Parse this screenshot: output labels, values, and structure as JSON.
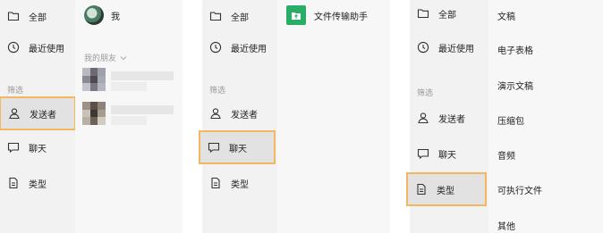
{
  "panel1": {
    "menu": [
      "全部",
      "最近使用"
    ],
    "filter_label": "筛选",
    "filters": [
      "发送者",
      "聊天",
      "类型"
    ],
    "me_label": "我",
    "friends_header": "我的朋友",
    "friends_chevron": "chevron-down-icon"
  },
  "panel2": {
    "menu": [
      "全部",
      "最近使用"
    ],
    "filter_label": "筛选",
    "filters": [
      "发送者",
      "聊天",
      "类型"
    ],
    "chat_item": "文件传输助手"
  },
  "panel3": {
    "menu": [
      "全部",
      "最近使用"
    ],
    "filter_label": "筛选",
    "filters": [
      "发送者",
      "聊天",
      "类型"
    ],
    "types": [
      "文稿",
      "电子表格",
      "演示文稿",
      "压缩包",
      "音频",
      "可执行文件",
      "其他"
    ]
  },
  "colors": {
    "highlight": "#f5b661",
    "green": "#2aae67"
  },
  "icons": [
    "folder-icon",
    "clock-icon",
    "person-icon",
    "chat-bubble-icon",
    "document-icon"
  ]
}
